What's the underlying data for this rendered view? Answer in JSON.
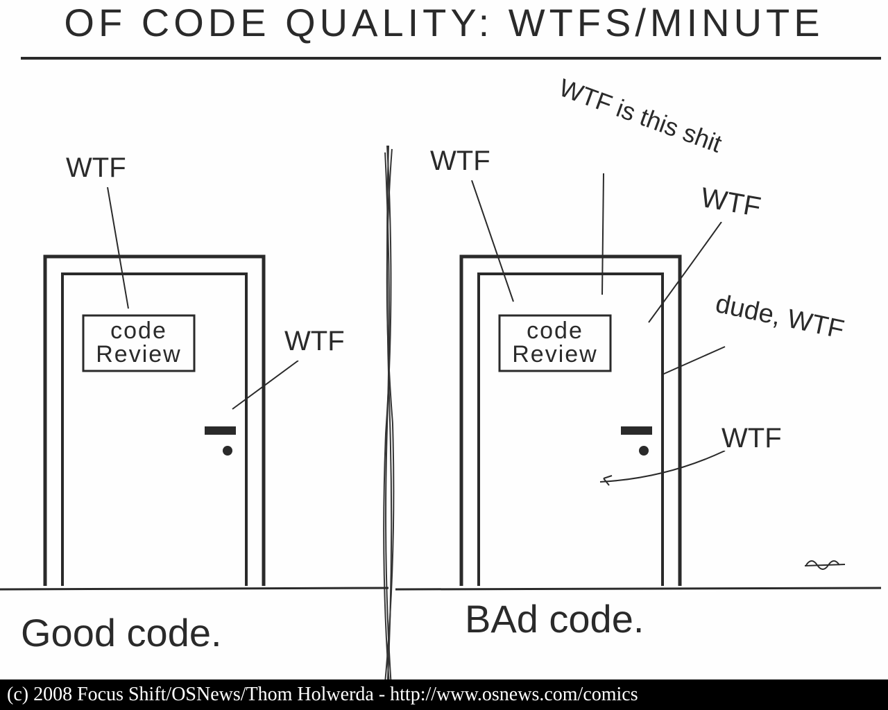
{
  "title": "OF CODE QUALITY: WTFS/MINUTE",
  "left": {
    "caption": "Good code.",
    "sign": {
      "line1": "code",
      "line2": "Review"
    },
    "wtfs": [
      {
        "text": "WTF"
      },
      {
        "text": "WTF"
      }
    ]
  },
  "right": {
    "caption": "BAd code.",
    "sign": {
      "line1": "code",
      "line2": "Review"
    },
    "wtfs": [
      {
        "text": "WTF"
      },
      {
        "text": "WTF is\nthis shit"
      },
      {
        "text": "WTF"
      },
      {
        "text": "dude,\nWTF"
      },
      {
        "text": "WTF"
      }
    ]
  },
  "footer": "(c) 2008 Focus Shift/OSNews/Thom Holwerda - http://www.osnews.com/comics"
}
